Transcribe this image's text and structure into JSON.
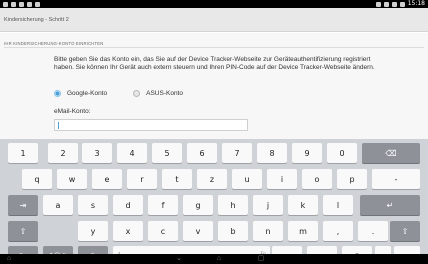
{
  "status_bar": {
    "time": "15:18",
    "left_icons": [
      "wifi-icon",
      "image-icon",
      "mail-icon",
      "screenshot-icon",
      "check-icon"
    ],
    "right_icons": [
      "bluetooth-icon",
      "signal-icon",
      "wifi-icon",
      "battery-icon"
    ]
  },
  "header": {
    "title": "Kindersicherung - Schritt 2"
  },
  "section": {
    "heading": "IHR KINDERSICHERUNG-KONTO EINRICHTEN",
    "description": "Bitte geben Sie das Konto ein, das Sie auf der Device Tracker-Webseite zur Geräteauthentifizierung registriert haben. Sie können Ihr Gerät auch extern steuern und Ihren PIN-Code auf der Device Tracker-Webseite ändern.",
    "radios": [
      {
        "label": "Google-Konto",
        "selected": true
      },
      {
        "label": "ASUS-Konto",
        "selected": false
      }
    ],
    "email_label": "eMail-Konto:",
    "email_value": ""
  },
  "keyboard": {
    "rows": [
      [
        "1",
        "2",
        "3",
        "4",
        "5",
        "6",
        "7",
        "8",
        "9",
        "0"
      ],
      [
        "q",
        "w",
        "e",
        "r",
        "t",
        "z",
        "u",
        "i",
        "o",
        "p",
        "-"
      ],
      [
        "a",
        "s",
        "d",
        "f",
        "g",
        "h",
        "j",
        "k",
        "l"
      ],
      [
        "y",
        "x",
        "c",
        "v",
        "b",
        "n",
        "m",
        ",",
        "."
      ]
    ],
    "bottom": {
      "lang": "En",
      "symbols": "1@#",
      "mic": "🎙",
      "left_arrow": "‹",
      "fn": "Fn",
      "dash": "_",
      "minus": "-",
      "at": "@",
      "dot": ".",
      "com": ".com"
    },
    "special": {
      "backspace": "⌫",
      "tab": "⇥",
      "enter": "↵",
      "shift": "⇧"
    }
  },
  "nav_bar": {
    "back": "⌂",
    "down": "⌄",
    "home": "⌂",
    "recents": "▢"
  }
}
